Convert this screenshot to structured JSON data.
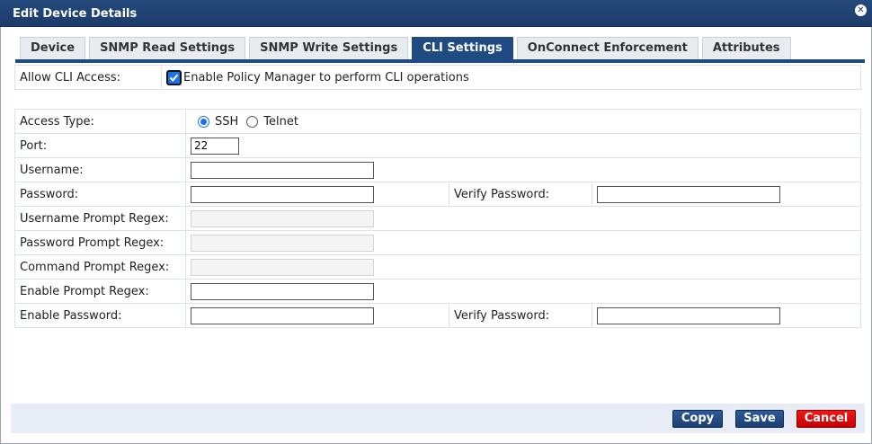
{
  "window": {
    "title": "Edit Device Details"
  },
  "tabs": [
    {
      "label": "Device",
      "active": false
    },
    {
      "label": "SNMP Read Settings",
      "active": false
    },
    {
      "label": "SNMP Write Settings",
      "active": false
    },
    {
      "label": "CLI Settings",
      "active": true
    },
    {
      "label": "OnConnect Enforcement",
      "active": false
    },
    {
      "label": "Attributes",
      "active": false
    }
  ],
  "cli_access": {
    "label": "Allow CLI Access:",
    "checkbox_label": "Enable Policy Manager to perform CLI operations",
    "checked": true
  },
  "form": {
    "access_type": {
      "label": "Access Type:",
      "options": [
        "SSH",
        "Telnet"
      ],
      "selected": "SSH"
    },
    "port": {
      "label": "Port:",
      "value": "22"
    },
    "username": {
      "label": "Username:",
      "value": ""
    },
    "password": {
      "label": "Password:",
      "value": "",
      "verify_label": "Verify Password:",
      "verify_value": ""
    },
    "username_prompt_regex": {
      "label": "Username Prompt Regex:",
      "value": "",
      "disabled": true
    },
    "password_prompt_regex": {
      "label": "Password Prompt Regex:",
      "value": "",
      "disabled": true
    },
    "command_prompt_regex": {
      "label": "Command Prompt Regex:",
      "value": "",
      "disabled": true
    },
    "enable_prompt_regex": {
      "label": "Enable Prompt Regex:",
      "value": ""
    },
    "enable_password": {
      "label": "Enable Password:",
      "value": "",
      "verify_label": "Verify Password:",
      "verify_value": ""
    }
  },
  "buttons": {
    "copy": "Copy",
    "save": "Save",
    "cancel": "Cancel"
  },
  "colors": {
    "title_bar": "#1c3c6b",
    "active_tab": "#1f4a82",
    "cancel": "#e00000",
    "footer": "#e7ecf6"
  }
}
